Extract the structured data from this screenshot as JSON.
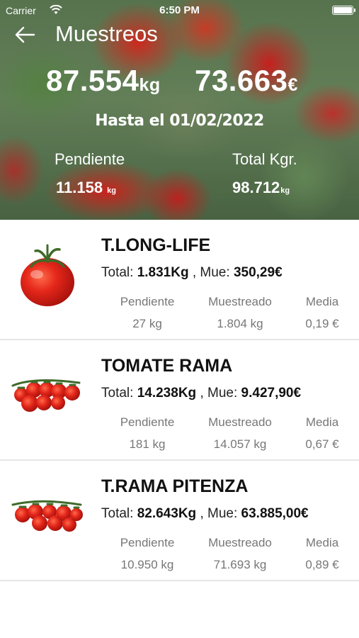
{
  "status_bar": {
    "carrier": "Carrier",
    "time": "6:50 PM"
  },
  "header": {
    "title": "Muestreos",
    "total_kg": {
      "value": "87.554",
      "unit": "kg"
    },
    "total_eur": {
      "value": "73.663",
      "unit": "€"
    },
    "until_text": "Hasta el 01/02/2022",
    "pending": {
      "label": "Pendiente",
      "value": "11.158",
      "unit": "kg"
    },
    "total_kgr": {
      "label": "Total Kgr.",
      "value": "98.712",
      "unit": "kg"
    }
  },
  "products": [
    {
      "name": "T.LONG-LIFE",
      "total_label": "Total:",
      "total_value": "1.831Kg",
      "mue_label": ", Mue:",
      "mue_value": "350,29€",
      "pendiente_label": "Pendiente",
      "pendiente_value": "27 kg",
      "muestreado_label": "Muestreado",
      "muestreado_value": "1.804 kg",
      "media_label": "Media",
      "media_value": "0,19 €",
      "icon": "single-tomato-icon"
    },
    {
      "name": "TOMATE RAMA",
      "total_label": "Total:",
      "total_value": "14.238Kg",
      "mue_label": ", Mue:",
      "mue_value": "9.427,90€",
      "pendiente_label": "Pendiente",
      "pendiente_value": "181 kg",
      "muestreado_label": "Muestreado",
      "muestreado_value": "14.057 kg",
      "media_label": "Media",
      "media_value": "0,67 €",
      "icon": "tomato-vine-icon"
    },
    {
      "name": "T.RAMA PITENZA",
      "total_label": "Total:",
      "total_value": "82.643Kg",
      "mue_label": ", Mue:",
      "mue_value": "63.885,00€",
      "pendiente_label": "Pendiente",
      "pendiente_value": "10.950 kg",
      "muestreado_label": "Muestreado",
      "muestreado_value": "71.693 kg",
      "media_label": "Media",
      "media_value": "0,89 €",
      "icon": "tomato-vine-icon"
    }
  ],
  "colors": {
    "tomato_red": "#e0231b",
    "stem_green": "#3f6b2a",
    "muted_text": "#777777"
  }
}
